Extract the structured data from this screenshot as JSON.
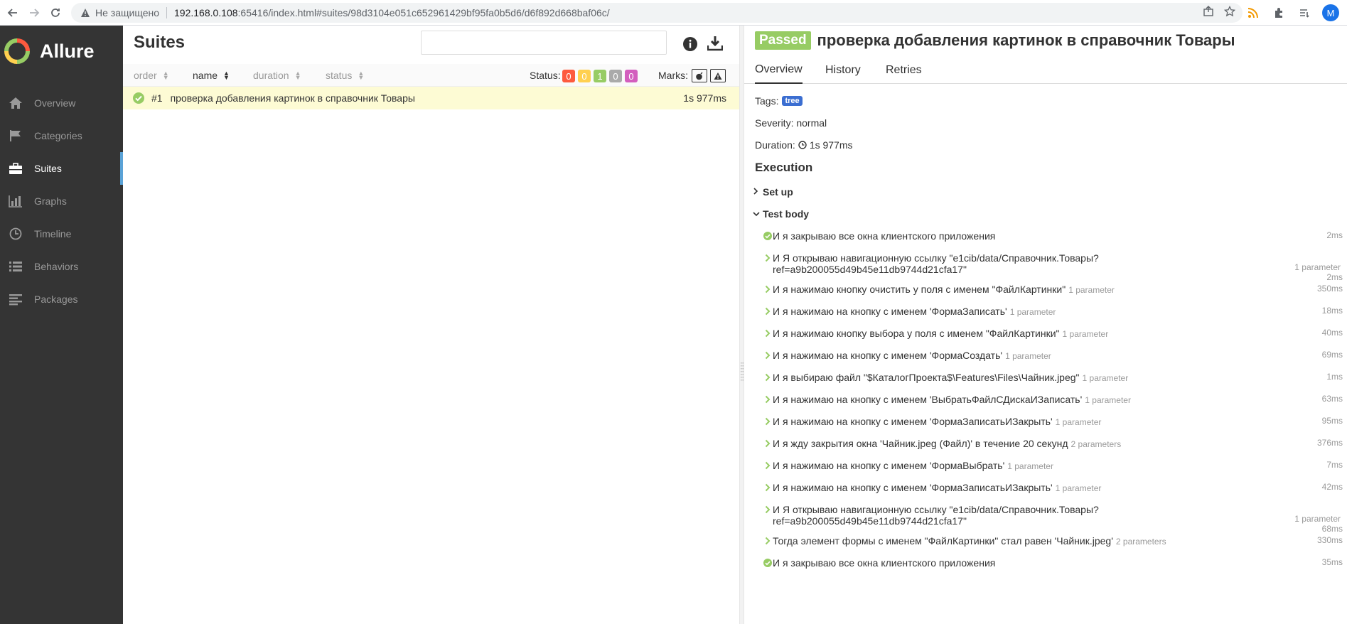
{
  "browser": {
    "insecure_label": "Не защищено",
    "url_host": "192.168.0.108",
    "url_rest": ":65416/index.html#suites/98d3104e051c652961429bf95fa0b5d6/d6f892d668baf06c/",
    "profile_initial": "M"
  },
  "sidebar": {
    "brand": "Allure",
    "items": [
      {
        "label": "Overview",
        "icon": "home-icon"
      },
      {
        "label": "Categories",
        "icon": "flag-icon"
      },
      {
        "label": "Suites",
        "icon": "briefcase-icon"
      },
      {
        "label": "Graphs",
        "icon": "bar-chart-icon"
      },
      {
        "label": "Timeline",
        "icon": "clock-icon"
      },
      {
        "label": "Behaviors",
        "icon": "list-icon"
      },
      {
        "label": "Packages",
        "icon": "align-left-icon"
      }
    ],
    "active": "Suites"
  },
  "suites": {
    "title": "Suites",
    "search_value": "",
    "columns": [
      "order",
      "name",
      "duration",
      "status"
    ],
    "status_label": "Status:",
    "status_counts": [
      {
        "value": "0",
        "color": "#fd5a3e"
      },
      {
        "value": "0",
        "color": "#ffd050"
      },
      {
        "value": "1",
        "color": "#97cc64"
      },
      {
        "value": "0",
        "color": "#aaaaaa"
      },
      {
        "value": "0",
        "color": "#d35ebe"
      }
    ],
    "marks_label": "Marks:",
    "rows": [
      {
        "order": "#1",
        "name": "проверка добавления картинок в справочник Товары",
        "duration": "1s 977ms",
        "status": "passed"
      }
    ]
  },
  "detail": {
    "status": "Passed",
    "title": "проверка добавления картинок в справочник Товары",
    "tabs": [
      "Overview",
      "History",
      "Retries"
    ],
    "tags_label": "Tags:",
    "tag": "tree",
    "severity": "Severity: normal",
    "duration_label": "Duration:",
    "duration": "1s 977ms",
    "execution_title": "Execution",
    "setup_label": "Set up",
    "body_label": "Test body",
    "steps": [
      {
        "text": "И я закрываю все окна клиентского приложения",
        "params": "",
        "time": "2ms",
        "kind": "check"
      },
      {
        "text": "И Я открываю навигационную ссылку \"e1cib/data/Справочник.Товары?",
        "text2": "ref=a9b200055d49b45e11db9744d21cfa17\"",
        "params": "1 parameter",
        "time": "2ms",
        "kind": "arrow"
      },
      {
        "text": "И я нажимаю кнопку очистить у поля с именем \"ФайлКартинки\"",
        "params": "1 parameter",
        "time": "350ms",
        "kind": "arrow"
      },
      {
        "text": "И я нажимаю на кнопку с именем 'ФормаЗаписать'",
        "params": "1 parameter",
        "time": "18ms",
        "kind": "arrow"
      },
      {
        "text": "И я нажимаю кнопку выбора у поля с именем \"ФайлКартинки\"",
        "params": "1 parameter",
        "time": "40ms",
        "kind": "arrow"
      },
      {
        "text": "И я нажимаю на кнопку с именем 'ФормаСоздать'",
        "params": "1 parameter",
        "time": "69ms",
        "kind": "arrow"
      },
      {
        "text": "И я выбираю файл \"$КаталогПроекта$\\Features\\Files\\Чайник.jpeg\"",
        "params": "1 parameter",
        "time": "1ms",
        "kind": "arrow"
      },
      {
        "text": "И я нажимаю на кнопку с именем 'ВыбратьФайлСДискаИЗаписать'",
        "params": "1 parameter",
        "time": "63ms",
        "kind": "arrow"
      },
      {
        "text": "И я нажимаю на кнопку с именем 'ФормаЗаписатьИЗакрыть'",
        "params": "1 parameter",
        "time": "95ms",
        "kind": "arrow"
      },
      {
        "text": "И я жду закрытия окна 'Чайник.jpeg (Файл)' в течение 20 секунд",
        "params": "2 parameters",
        "time": "376ms",
        "kind": "arrow"
      },
      {
        "text": "И я нажимаю на кнопку с именем 'ФормаВыбрать'",
        "params": "1 parameter",
        "time": "7ms",
        "kind": "arrow"
      },
      {
        "text": "И я нажимаю на кнопку с именем 'ФормаЗаписатьИЗакрыть'",
        "params": "1 parameter",
        "time": "42ms",
        "kind": "arrow"
      },
      {
        "text": "И Я открываю навигационную ссылку \"e1cib/data/Справочник.Товары?",
        "text2": "ref=a9b200055d49b45e11db9744d21cfa17\"",
        "params": "1 parameter",
        "time": "68ms",
        "kind": "arrow"
      },
      {
        "text": "Тогда элемент формы с именем \"ФайлКартинки\" стал равен 'Чайник.jpeg'",
        "params": "2 parameters",
        "time": "330ms",
        "kind": "arrow"
      },
      {
        "text": "И я закрываю все окна клиентского приложения",
        "params": "",
        "time": "35ms",
        "kind": "check"
      }
    ]
  }
}
